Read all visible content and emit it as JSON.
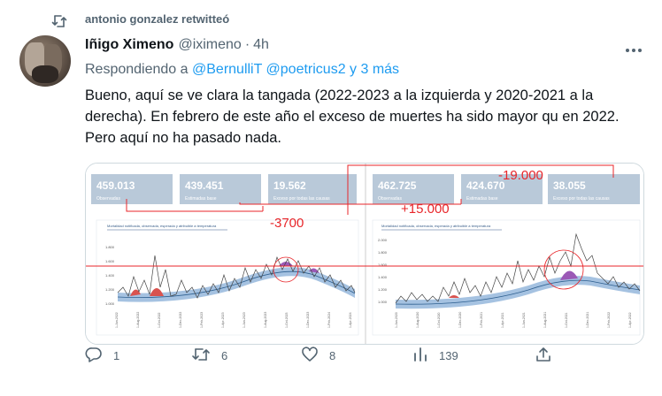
{
  "retweet": {
    "label": "antonio gonzalez retwitteó"
  },
  "tweet": {
    "author_name": "Iñigo Ximeno",
    "author_handle": "@iximeno",
    "separator": "·",
    "time": "4h",
    "reply_prefix": "Respondiendo a",
    "reply_mentions": "@BernulliT @poetricus2 y 3 más",
    "text": "Bueno, aquí se ve clara la tangada (2022-2023 a la izquierda y 2020-2021 a la derecha). En febrero de este año el exceso de muertes ha sido mayor qu en 2022. Pero aquí no ha pasado nada.",
    "more_icon": "more-options-icon"
  },
  "media": {
    "left_panel": {
      "stats": [
        {
          "value": "459.013",
          "label": "Observadas"
        },
        {
          "value": "439.451",
          "label": "Estimadas base"
        },
        {
          "value": "19.562",
          "label": "Exceso por todas las causas"
        }
      ],
      "chart_title": "Mortalidad notificada, observada, esperada y atribuible a temperatura",
      "y_ticks": [
        "1.800",
        "1.600",
        "1.400",
        "1.200",
        "1.000"
      ]
    },
    "right_panel": {
      "stats": [
        {
          "value": "462.725",
          "label": "Observadas"
        },
        {
          "value": "424.670",
          "label": "Estimadas base"
        },
        {
          "value": "38.055",
          "label": "Exceso por todas las causas"
        }
      ],
      "chart_title": "Mortalidad notificada, observada, esperada y atribuible a temperatura",
      "y_ticks": [
        "2.000",
        "1.800",
        "1.600",
        "1.400",
        "1.200",
        "1.000"
      ]
    },
    "annotations": {
      "left_diff": "-3700",
      "mid_diff": "+15.000",
      "right_diff": "-19.000"
    },
    "colors": {
      "accent_red": "#e8262a",
      "card_bg": "#b9c9d9",
      "band_blue": "#8fb3d9",
      "excess_red": "#d9534f",
      "excess_purple": "#9b59b6"
    }
  },
  "actions": {
    "replies": "1",
    "retweets": "6",
    "likes": "8",
    "views": "139"
  }
}
